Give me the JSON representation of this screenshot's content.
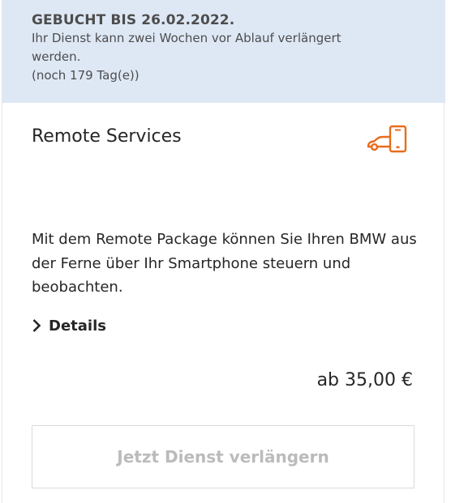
{
  "banner": {
    "title": "GEBUCHT BIS 26.02.2022.",
    "line1": "Ihr Dienst kann zwei Wochen vor Ablauf verlängert",
    "line2": "werden.",
    "line3": "(noch 179 Tag(e))"
  },
  "service": {
    "title": "Remote Services",
    "icon": "remote-car-phone-icon",
    "description": "Mit dem Remote Package können Sie Ihren BMW aus der Ferne über Ihr Smartphone steuern und beobachten.",
    "details_label": "Details",
    "price": "ab 35,00 €",
    "cta_label": "Jetzt Dienst verlängern"
  },
  "colors": {
    "banner_bg": "#dee8f5",
    "accent": "#e96c1c",
    "cta_text_disabled": "#bbbbbb"
  }
}
